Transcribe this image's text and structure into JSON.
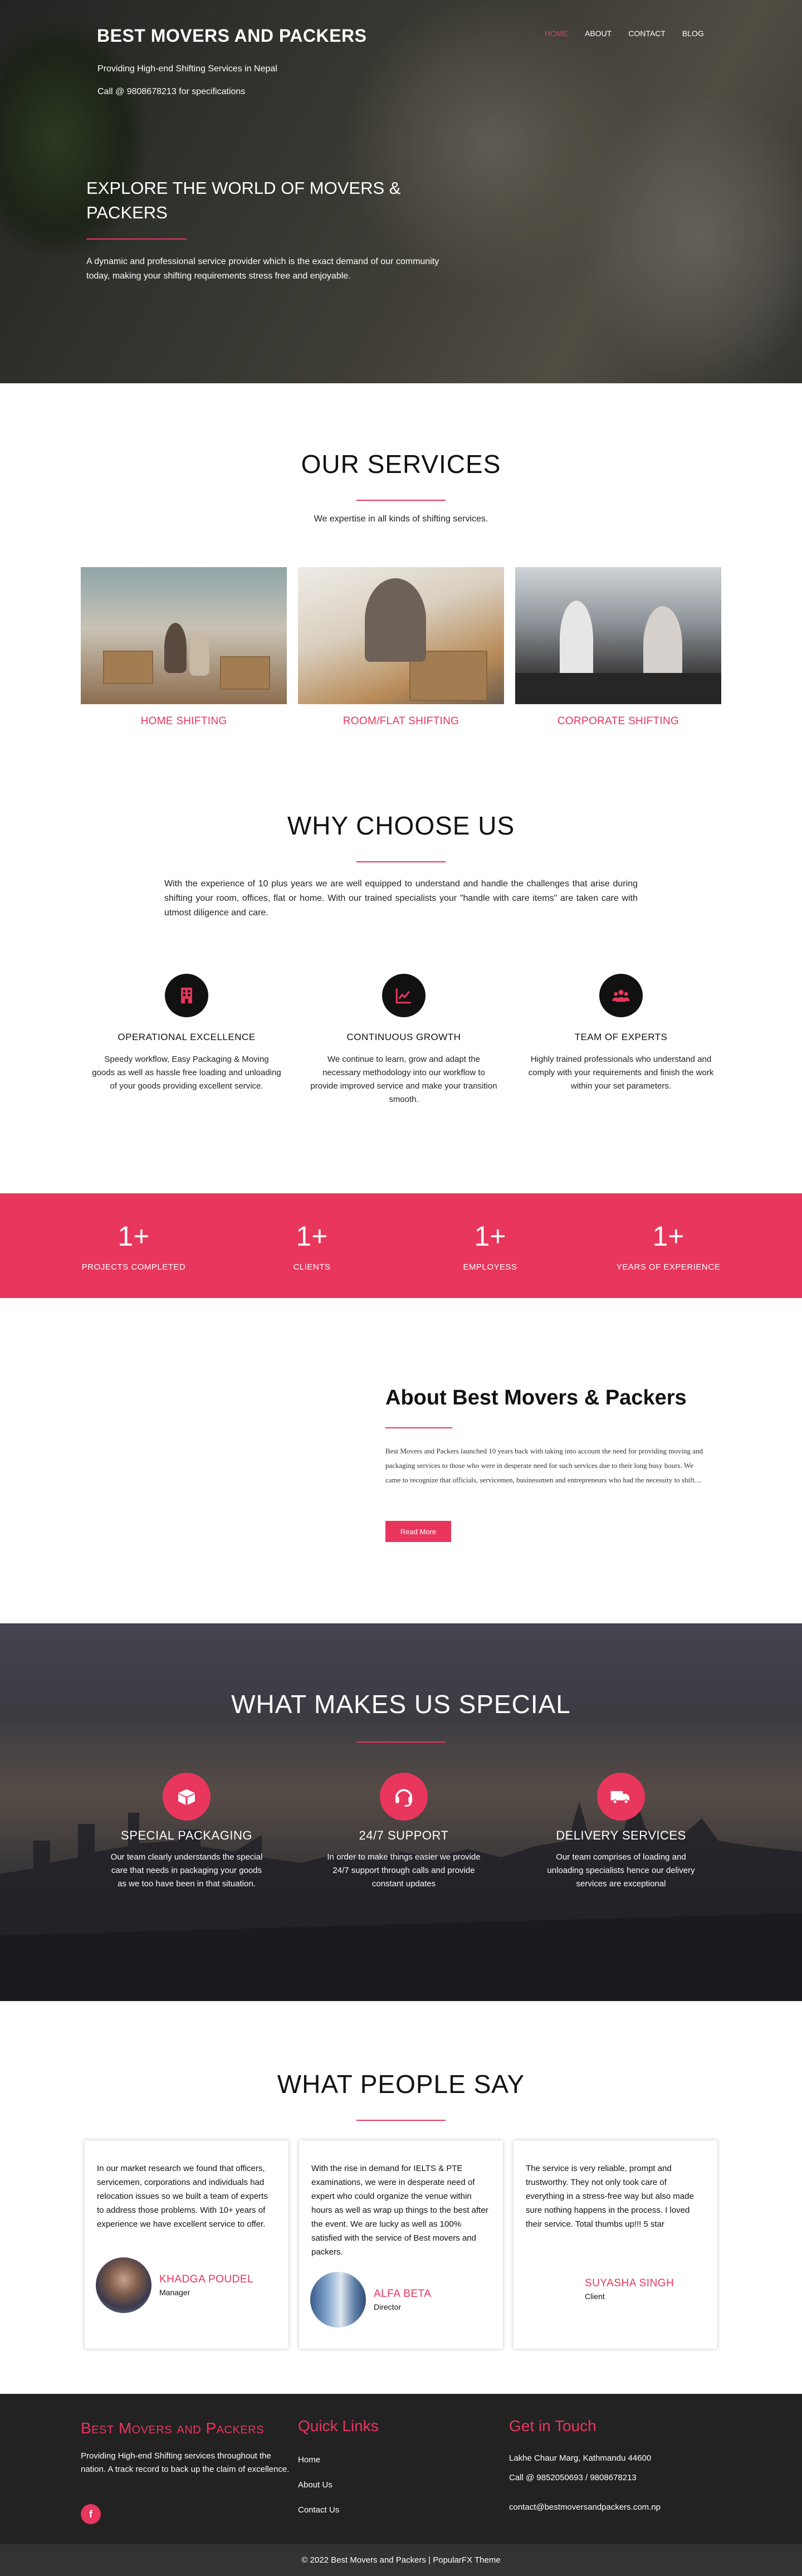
{
  "hero": {
    "brand": "BEST MOVERS AND PACKERS",
    "tagline": "Providing High-end Shifting Services in Nepal",
    "phone": "Call @ 9808678213 for specifications",
    "nav": [
      "HOME",
      "ABOUT",
      "CONTACT",
      "BLOG"
    ],
    "title": "EXPLORE THE WORLD OF MOVERS & PACKERS",
    "text": "A dynamic and professional service provider which is the exact demand of our community today, making your shifting requirements stress free and enjoyable."
  },
  "services": {
    "title": "OUR SERVICES",
    "subtitle": "We expertise in all kinds of shifting services.",
    "items": [
      "HOME SHIFTING",
      "ROOM/FLAT SHIFTING",
      "CORPORATE SHIFTING"
    ]
  },
  "why": {
    "title": "WHY CHOOSE US",
    "text": "With the experience of 10 plus years we are well equipped to understand and handle the challenges that arise during shifting your room, offices, flat or home. With our trained specialists your \"handle with care items\" are taken care with utmost diligence and care.",
    "features": [
      {
        "icon": "building-icon",
        "title": "OPERATIONAL EXCELLENCE",
        "text": "Speedy workflow, Easy Packaging & Moving goods as well as hassle free loading and unloading of your goods providing excellent service."
      },
      {
        "icon": "chart-line-icon",
        "title": "CONTINUOUS GROWTH",
        "text": "We continue to learn, grow and adapt the necessary methodology into our workflow to provide improved service and make your transition smooth."
      },
      {
        "icon": "users-icon",
        "title": "TEAM OF EXPERTS",
        "text": "Highly trained professionals who understand and comply with your requirements and finish the work within your set parameters."
      }
    ]
  },
  "stats": [
    {
      "num": "1+",
      "label": "PROJECTS COMPLETED"
    },
    {
      "num": "1+",
      "label": "CLIENTS"
    },
    {
      "num": "1+",
      "label": "EMPLOYESS"
    },
    {
      "num": "1+",
      "label": "YEARS OF EXPERIENCE"
    }
  ],
  "about": {
    "title": "About Best Movers & Packers",
    "text": "Best Movers and Packers launched 10 years back with taking into account the need for providing moving and packaging services to those who were in desperate need for such services due to their long busy hours. We came to recognize that officials, servicemen, businessmen and entrepreneurs who had the necessity to shift....",
    "button": "Read More"
  },
  "special": {
    "title": "WHAT MAKES US SPECIAL",
    "items": [
      {
        "icon": "box-icon",
        "title": "SPECIAL PACKAGING",
        "text": "Our team clearly understands the special care that needs in packaging your goods as we too have been in that situation."
      },
      {
        "icon": "headset-icon",
        "title": "24/7 SUPPORT",
        "text": "In order to make things easier we provide 24/7 support through calls and provide constant updates"
      },
      {
        "icon": "truck-icon",
        "title": "DELIVERY SERVICES",
        "text": "Our team comprises of loading and unloading specialists hence our delivery services are exceptional"
      }
    ]
  },
  "people": {
    "title": "WHAT PEOPLE SAY",
    "items": [
      {
        "text": "In our market research we found that officers, servicemen, corporations and individuals had relocation issues so we built a team of experts to address those problems. With 10+ years of experience we have excellent service to offer.",
        "name": "KHADGA POUDEL",
        "role": "Manager"
      },
      {
        "text": "With the rise in demand for IELTS & PTE examinations, we were in desperate need of expert who could organize the venue within hours as well as wrap up things to the best after the event. We are lucky as well as 100% satisfied with the service of Best movers and packers.",
        "name": "ALFA BETA",
        "role": "Director"
      },
      {
        "text": "The service is very reliable, prompt and trustworthy. They not only took care of everything in a stress-free way but also made sure nothing happens in the process. I loved their service. Total thumbs up!!! 5 star",
        "name": "SUYASHA SINGH",
        "role": "Client"
      }
    ]
  },
  "footer": {
    "brand": "Best Movers and Packers",
    "text": "Providing High-end Shifting services throughout the nation. A track record to back up the claim of excellence.",
    "fb": "f",
    "links_title": "Quick Links",
    "links": [
      "Home",
      "About Us",
      "Contact Us"
    ],
    "contact_title": "Get in Touch",
    "address": "Lakhe Chaur Marg, Kathmandu 44600",
    "phones": "Call @ 9852050693 / 9808678213",
    "email": "contact@bestmoversandpackers.com.np",
    "copyright": "© 2022 Best Movers and Packers | PopularFX Theme"
  },
  "colors": {
    "accent": "#e8365d",
    "dark": "#222222"
  }
}
